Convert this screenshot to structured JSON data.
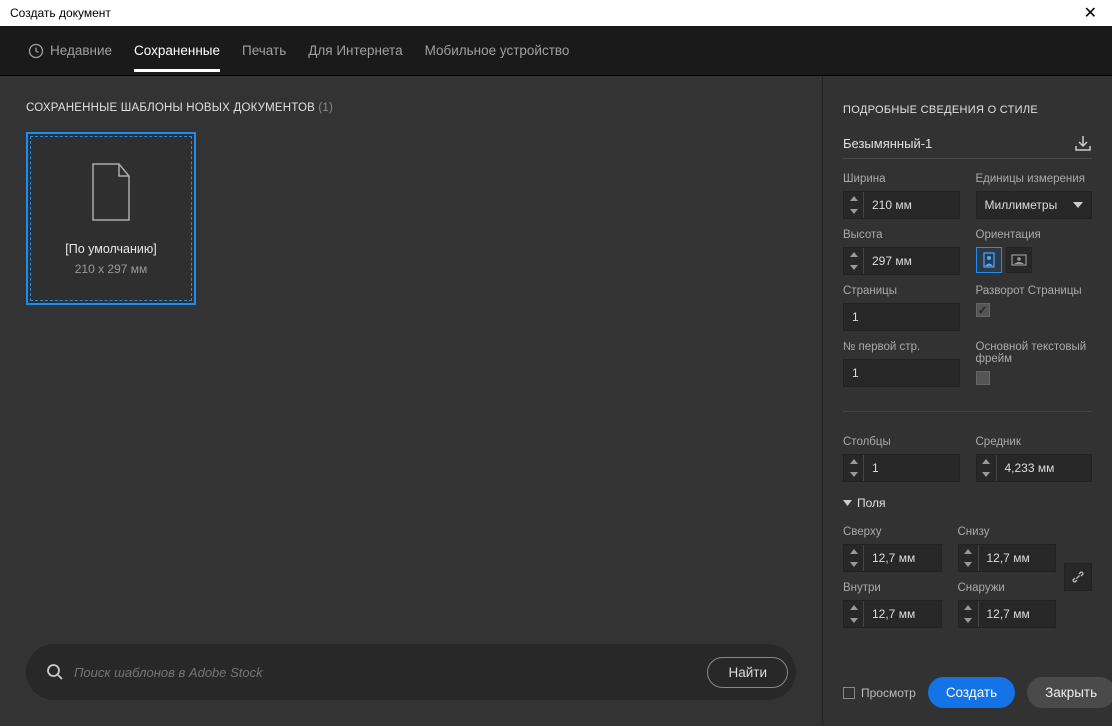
{
  "window": {
    "title": "Создать документ"
  },
  "tabs": {
    "recent": "Недавние",
    "saved": "Сохраненные",
    "print": "Печать",
    "web": "Для Интернета",
    "mobile": "Мобильное устройство"
  },
  "leftPanel": {
    "header": "СОХРАНЕННЫЕ ШАБЛОНЫ НОВЫХ ДОКУМЕНТОВ",
    "count": "(1)",
    "preset": {
      "name": "[По умолчанию]",
      "dimensions": "210 x 297 мм"
    },
    "search": {
      "placeholder": "Поиск шаблонов в Adobe Stock",
      "button": "Найти"
    }
  },
  "rightPanel": {
    "title": "ПОДРОБНЫЕ СВЕДЕНИЯ О СТИЛЕ",
    "docName": "Безымянный-1",
    "labels": {
      "width": "Ширина",
      "units": "Единицы измерения",
      "height": "Высота",
      "orientation": "Ориентация",
      "pages": "Страницы",
      "spread": "Разворот Страницы",
      "startPage": "№ первой стр.",
      "textFrame": "Основной текстовый фрейм",
      "columns": "Столбцы",
      "gutter": "Средник",
      "margins": "Поля",
      "top": "Сверху",
      "bottom": "Снизу",
      "inside": "Внутри",
      "outside": "Снаружи"
    },
    "values": {
      "width": "210 мм",
      "height": "297 мм",
      "units": "Миллиметры",
      "pages": "1",
      "startPage": "1",
      "columns": "1",
      "gutter": "4,233 мм",
      "top": "12,7 мм",
      "bottom": "12,7 мм",
      "inside": "12,7 мм",
      "outside": "12,7 мм"
    }
  },
  "actions": {
    "preview": "Просмотр",
    "create": "Создать",
    "close": "Закрыть"
  }
}
